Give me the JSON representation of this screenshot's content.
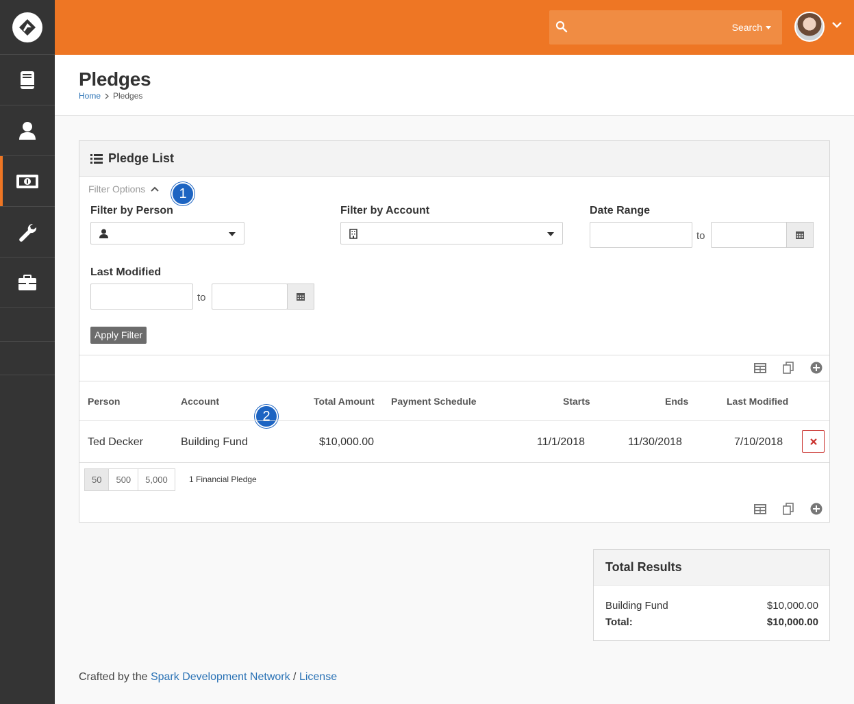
{
  "header": {
    "search_label": "Search",
    "search_placeholder": ""
  },
  "sidebar": {
    "items": [
      {
        "icon": "book-icon"
      },
      {
        "icon": "person-icon"
      },
      {
        "icon": "money-icon",
        "active": true
      },
      {
        "icon": "wrench-icon"
      },
      {
        "icon": "briefcase-icon"
      }
    ]
  },
  "page": {
    "title": "Pledges",
    "breadcrumb": [
      "Home",
      "Pledges"
    ]
  },
  "panel": {
    "title": "Pledge List",
    "filter_toggle": "Filter Options",
    "annotation_1": "1",
    "annotation_2": "2",
    "filters": {
      "person_label": "Filter by Person",
      "account_label": "Filter by Account",
      "date_range_label": "Date Range",
      "last_modified_label": "Last Modified",
      "to": "to",
      "apply": "Apply Filter"
    },
    "columns": [
      "Person",
      "Account",
      "Total Amount",
      "Payment Schedule",
      "Starts",
      "Ends",
      "Last Modified"
    ],
    "rows": [
      {
        "person": "Ted Decker",
        "account": "Building Fund",
        "total": "$10,000.00",
        "schedule": "",
        "starts": "11/1/2018",
        "ends": "11/30/2018",
        "modified": "7/10/2018"
      }
    ],
    "page_sizes": [
      "50",
      "500",
      "5,000"
    ],
    "selected_page_size": "50",
    "count_text": "1 Financial Pledge"
  },
  "totals": {
    "title": "Total Results",
    "rows": [
      {
        "label": "Building Fund",
        "value": "$10,000.00"
      }
    ],
    "total_label": "Total:",
    "total_value": "$10,000.00"
  },
  "footer": {
    "prefix": "Crafted by the",
    "link1": "Spark Development Network",
    "sep": "/",
    "link2": "License"
  },
  "colors": {
    "accent": "#ee7624",
    "sidebar": "#343434",
    "link": "#2a72b5",
    "badge": "#1d64c2",
    "danger": "#c9302c"
  }
}
